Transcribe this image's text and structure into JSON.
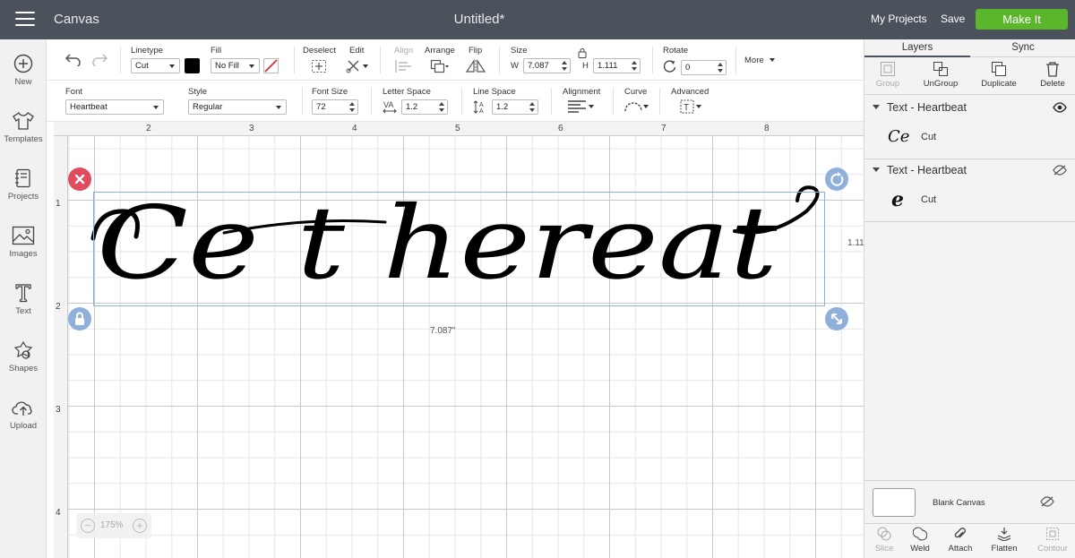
{
  "topbar": {
    "menu_icon": "hamburger-icon",
    "app_title": "Canvas",
    "doc_title": "Untitled*",
    "my_projects": "My Projects",
    "save": "Save",
    "make_it": "Make It",
    "make_it_color": "#5bb62c",
    "bar_color": "#4b525b"
  },
  "sidebar": {
    "items": [
      {
        "label": "New",
        "icon": "plus-circle-icon"
      },
      {
        "label": "Templates",
        "icon": "shirt-icon"
      },
      {
        "label": "Projects",
        "icon": "notebook-icon"
      },
      {
        "label": "Images",
        "icon": "image-icon"
      },
      {
        "label": "Text",
        "icon": "text-t-icon"
      },
      {
        "label": "Shapes",
        "icon": "shapes-icon"
      },
      {
        "label": "Upload",
        "icon": "cloud-upload-icon"
      }
    ]
  },
  "toolbar1": {
    "linetype_label": "Linetype",
    "linetype_value": "Cut",
    "fill_label": "Fill",
    "fill_value": "No Fill",
    "deselect_label": "Deselect",
    "edit_label": "Edit",
    "align_label": "Align",
    "arrange_label": "Arrange",
    "flip_label": "Flip",
    "size_label": "Size",
    "w_label": "W",
    "w_value": "7.087",
    "h_label": "H",
    "h_value": "1.111",
    "rotate_label": "Rotate",
    "rotate_value": "0",
    "more_label": "More",
    "color_swatch": "#000000"
  },
  "toolbar2": {
    "font_label": "Font",
    "font_value": "Heartbeat",
    "style_label": "Style",
    "style_value": "Regular",
    "font_size_label": "Font Size",
    "font_size_value": "72",
    "letter_space_label": "Letter Space",
    "letter_space_value": "1.2",
    "line_space_label": "Line Space",
    "line_space_value": "1.2",
    "alignment_label": "Alignment",
    "curve_label": "Curve",
    "advanced_label": "Advanced"
  },
  "canvas": {
    "ruler_top": [
      "2",
      "3",
      "4",
      "5",
      "6",
      "7",
      "8"
    ],
    "ruler_left": [
      "1",
      "2",
      "3",
      "4"
    ],
    "text_content": "Ce t hereat",
    "width_readout": "7.087\"",
    "height_readout": "1.11\"",
    "zoom_value": "175%",
    "zoom_minus": "−",
    "zoom_plus": "+",
    "handle_delete_color": "#e04c5c",
    "handle_color": "#8fb0da"
  },
  "rpanel": {
    "tabs": [
      "Layers",
      "Sync"
    ],
    "actions": [
      {
        "label": "Group",
        "icon": "group-icon"
      },
      {
        "label": "UnGroup",
        "icon": "ungroup-icon"
      },
      {
        "label": "Duplicate",
        "icon": "duplicate-icon"
      },
      {
        "label": "Delete",
        "icon": "trash-icon"
      }
    ],
    "layers": [
      {
        "title": "Text - Heartbeat",
        "thumb": "Ce",
        "type": "Cut",
        "visible": true
      },
      {
        "title": "Text - Heartbeat",
        "thumb": "e",
        "type": "Cut",
        "visible": false
      }
    ],
    "blank_canvas": "Blank Canvas",
    "bottom": [
      {
        "label": "Slice",
        "icon": "slice-icon"
      },
      {
        "label": "Weld",
        "icon": "weld-icon"
      },
      {
        "label": "Attach",
        "icon": "paperclip-icon"
      },
      {
        "label": "Flatten",
        "icon": "flatten-icon"
      },
      {
        "label": "Contour",
        "icon": "contour-icon"
      }
    ]
  }
}
